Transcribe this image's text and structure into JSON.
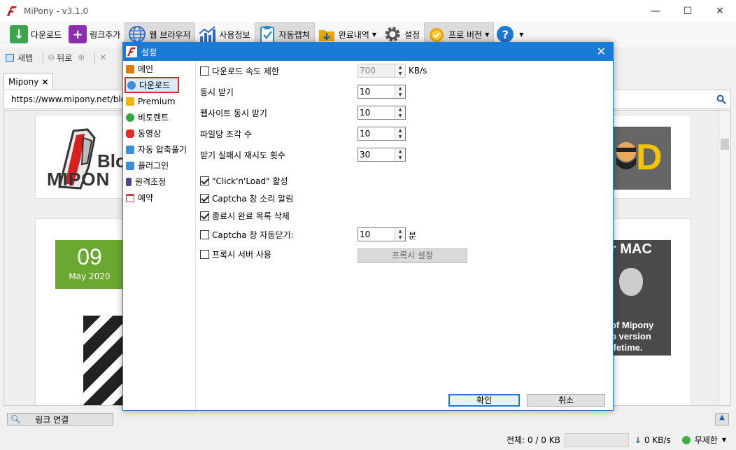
{
  "window": {
    "title": "MiPony - v3.1.0",
    "controls": {
      "minimize": "—",
      "maximize": "☐",
      "close": "✕"
    }
  },
  "toolbar": {
    "items": [
      {
        "label": "다운로드",
        "icon": "download-icon",
        "color": "#3fa34d"
      },
      {
        "label": "링크추가",
        "icon": "plus-icon",
        "color": "#8b2fb0"
      },
      {
        "label": "웹 브라우저",
        "icon": "globe-icon",
        "color": "#2a6fc1",
        "active": true
      },
      {
        "label": "사용정보",
        "icon": "bar-chart-icon",
        "color": "#2a6fc1"
      },
      {
        "label": "자동캡쳐",
        "icon": "clipboard-check-icon",
        "color": "#2d8fbf",
        "active": true
      },
      {
        "label": "완료내역",
        "icon": "folder-download-icon",
        "color": "#e8a800",
        "dropdown": true
      },
      {
        "label": "설정",
        "icon": "gear-icon",
        "color": "#555555"
      },
      {
        "label": "프로 버전",
        "icon": "medal-icon",
        "color": "#f0a500",
        "dropdown": true,
        "active": true
      },
      {
        "label": "?",
        "icon": "help-icon",
        "color": "#1e78d7",
        "dropdown": true
      }
    ]
  },
  "toolbar2": {
    "new_tab": "새탭",
    "back": "뒤로"
  },
  "browser": {
    "tab_label": "Mipony",
    "tab_close": "×",
    "url": "https://www.mipony.net/blog",
    "page": {
      "blog_text_top": "Blo",
      "blog_text_bottom": "MIPON",
      "right_logo_letter": "D",
      "date_day": "09",
      "date_month": "May 2020",
      "mac_title": "r MAC",
      "mac_line1": "of Mipony",
      "mac_line2": "o version",
      "mac_line3": "ifetime."
    }
  },
  "bottom": {
    "link_button": "링크 연결",
    "total_label": "전체: 0 / 0 KB",
    "speed": "0 KB/s",
    "limit_mode": "무제한"
  },
  "dialog": {
    "title": "설정",
    "nav": [
      {
        "label": "메인",
        "icon": "house-icon",
        "color": "#e07b00"
      },
      {
        "label": "다운로드",
        "icon": "download-small-icon",
        "color": "#3a8fd8",
        "selected": true
      },
      {
        "label": "Premium",
        "icon": "crown-icon",
        "color": "#f0b400"
      },
      {
        "label": "비토렌트",
        "icon": "utorrent-icon",
        "color": "#2ea84a"
      },
      {
        "label": "동영상",
        "icon": "youtube-icon",
        "color": "#e52d27"
      },
      {
        "label": "자동 압축풀기",
        "icon": "zip-icon",
        "color": "#3a8fd8"
      },
      {
        "label": "플러그인",
        "icon": "plugin-icon",
        "color": "#3a8fd8"
      },
      {
        "label": "원격조정",
        "icon": "phone-icon",
        "color": "#4a4a8a"
      },
      {
        "label": "예약",
        "icon": "calendar-icon",
        "color": "#d04040"
      }
    ],
    "settings": {
      "speed_limit": {
        "label": "다운로드 속도 제한",
        "checked": false,
        "value": "700",
        "unit": "KB/s"
      },
      "concurrent": {
        "label": "동시 받기",
        "value": "10"
      },
      "site_concurrent": {
        "label": "웹사이트 동시 받기",
        "value": "10"
      },
      "pieces": {
        "label": "파일당 조각 수",
        "value": "10"
      },
      "retries": {
        "label": "받기 실패시 재시도 횟수",
        "value": "30"
      },
      "click_n_load": {
        "label": "\"Click'n'Load\" 활성",
        "checked": true
      },
      "captcha_sound": {
        "label": "Captcha 창 소리 알림",
        "checked": true
      },
      "clear_on_exit": {
        "label": "종료시 완료 목록 삭제",
        "checked": true
      },
      "captcha_autoclose": {
        "label": "Captcha 창 자동닫기:",
        "checked": false,
        "value": "10",
        "unit": "분"
      },
      "proxy": {
        "label": "프록시 서버 사용",
        "checked": false,
        "button": "프록시 설정"
      }
    },
    "ok": "확인",
    "cancel": "취소"
  }
}
